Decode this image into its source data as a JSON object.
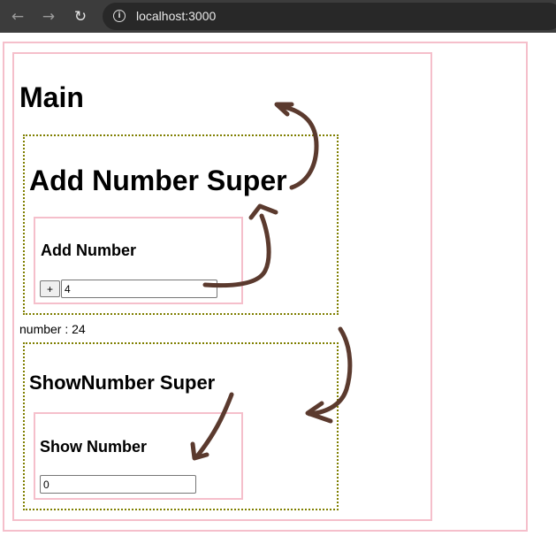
{
  "browser": {
    "back_icon": "←",
    "forward_icon": "→",
    "reload_icon": "↻",
    "info_icon": "i",
    "url": "localhost:3000"
  },
  "main": {
    "title": "Main",
    "number_label": "number : 24"
  },
  "add_super": {
    "title": "Add Number Super"
  },
  "add_number": {
    "title": "Add Number",
    "button_label": "+",
    "input_value": "4"
  },
  "show_super": {
    "title": "ShowNumber Super"
  },
  "show_number": {
    "title": "Show Number",
    "input_value": "0"
  },
  "colors": {
    "component_border": "#f5bfcb",
    "super_border": "#7f7f00",
    "annotation_arrow": "#5b3a2e"
  },
  "icons": [
    "back-arrow-icon",
    "forward-arrow-icon",
    "reload-icon",
    "info-icon"
  ]
}
